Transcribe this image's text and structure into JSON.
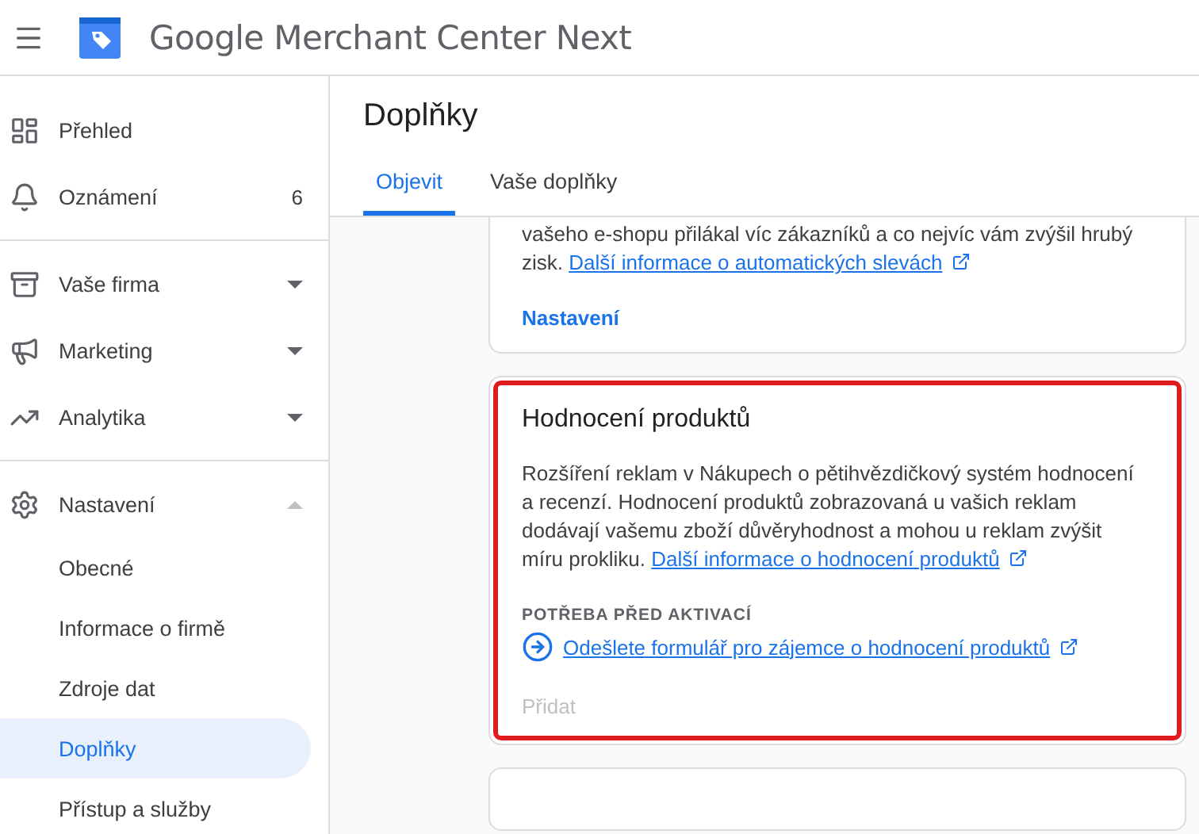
{
  "app": {
    "title": "Google Merchant Center Next"
  },
  "sidebar": {
    "sections": [
      {
        "items": [
          {
            "label": "Přehled"
          },
          {
            "label": "Oznámení",
            "count": "6"
          }
        ]
      },
      {
        "items": [
          {
            "label": "Vaše firma",
            "expanded": false
          },
          {
            "label": "Marketing",
            "expanded": false
          },
          {
            "label": "Analytika",
            "expanded": false
          }
        ]
      },
      {
        "items": [
          {
            "label": "Nastavení",
            "expanded": true,
            "children": [
              {
                "label": "Obecné",
                "selected": false
              },
              {
                "label": "Informace o firmě",
                "selected": false
              },
              {
                "label": "Zdroje dat",
                "selected": false
              },
              {
                "label": "Doplňky",
                "selected": true
              },
              {
                "label": "Přístup a služby",
                "selected": false
              }
            ]
          }
        ]
      }
    ]
  },
  "page": {
    "title": "Doplňky",
    "tabs": [
      {
        "label": "Objevit",
        "selected": true
      },
      {
        "label": "Vaše doplňky",
        "selected": false
      }
    ],
    "cards": [
      {
        "kind": "partial",
        "highlighted": false,
        "description": "vašeho e-shopu přilákal víc zákazníků a co nejvíc vám zvýšil hrubý zisk.",
        "link": "Další informace o automatických slevách",
        "action": {
          "label": "Nastavení",
          "disabled": false
        }
      },
      {
        "kind": "full",
        "highlighted": true,
        "title": "Hodnocení produktů",
        "description": "Rozšíření reklam v Nákupech o pětihvězdičkový systém hodnocení a recenzí. Hodnocení produktů zobrazovaná u vašich reklam dodávají vašemu zboží důvěryhodnost a mohou u reklam zvýšit míru prokliku.",
        "link": "Další informace o hodnocení produktů",
        "requirement": {
          "heading": "POTŘEBA PŘED AKTIVACÍ",
          "link": "Odešlete formulář pro zájemce o hodnocení produktů"
        },
        "action": {
          "label": "Přidat",
          "disabled": true
        }
      },
      {
        "kind": "empty"
      }
    ]
  }
}
